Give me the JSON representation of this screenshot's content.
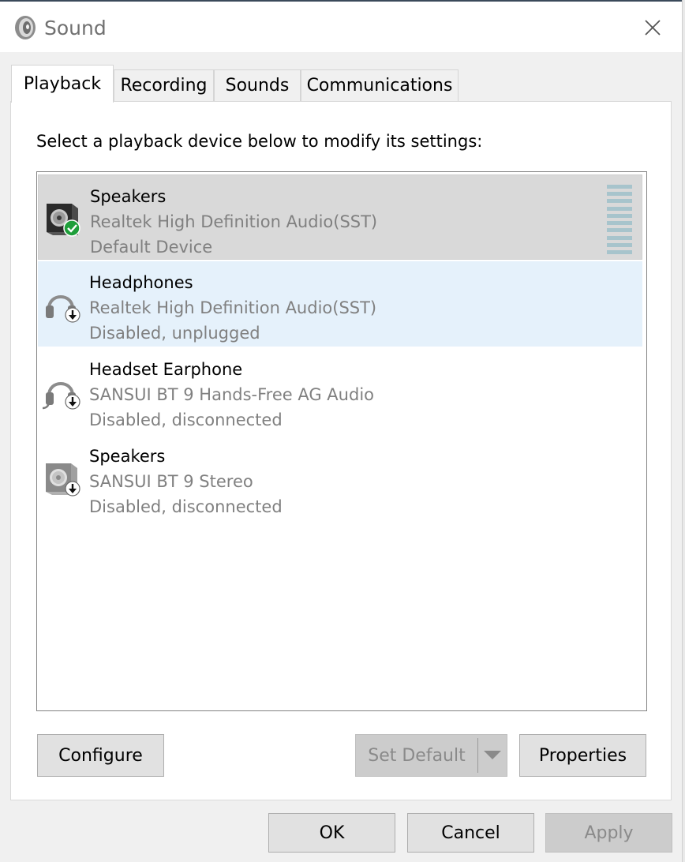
{
  "window": {
    "title": "Sound"
  },
  "tabs": [
    {
      "label": "Playback"
    },
    {
      "label": "Recording"
    },
    {
      "label": "Sounds"
    },
    {
      "label": "Communications"
    }
  ],
  "playback": {
    "instruction": "Select a playback device below to modify its settings:",
    "devices": [
      {
        "name": "Speakers",
        "driver": "Realtek High Definition Audio(SST)",
        "status": "Default Device",
        "icon": "speaker-icon",
        "badge": "default-check-icon"
      },
      {
        "name": "Headphones",
        "driver": "Realtek High Definition Audio(SST)",
        "status": "Disabled, unplugged",
        "icon": "headphones-icon",
        "badge": "down-arrow-badge-icon"
      },
      {
        "name": "Headset Earphone",
        "driver": "SANSUI BT 9 Hands-Free AG Audio",
        "status": "Disabled, disconnected",
        "icon": "headset-icon",
        "badge": "down-arrow-badge-icon"
      },
      {
        "name": "Speakers",
        "driver": "SANSUI BT 9 Stereo",
        "status": "Disabled, disconnected",
        "icon": "speaker-icon",
        "badge": "down-arrow-badge-icon"
      }
    ]
  },
  "buttons": {
    "configure": "Configure",
    "set_default": "Set Default",
    "properties": "Properties",
    "ok": "OK",
    "cancel": "Cancel",
    "apply": "Apply"
  },
  "colors": {
    "selected_row": "#d9d9d9",
    "hover_row": "#e5f1fb",
    "default_badge": "#1e9e3a",
    "level_meter": "#a7c4cc"
  }
}
